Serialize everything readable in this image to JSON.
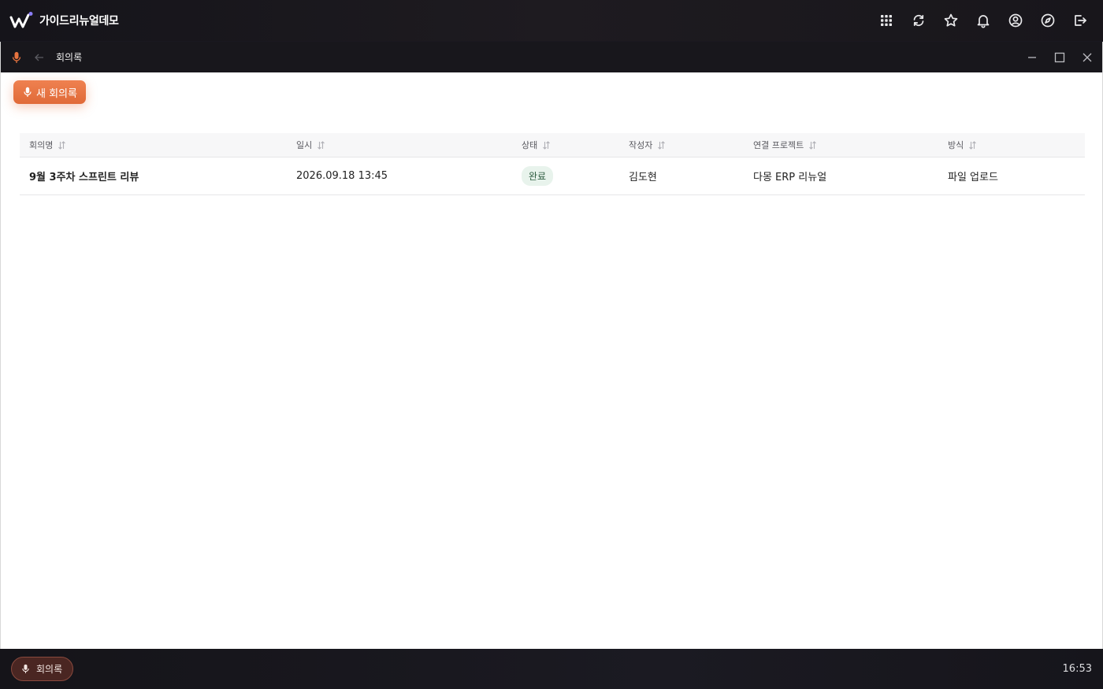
{
  "app": {
    "name": "가이드리뉴얼데모",
    "top_icons": [
      "apps-grid-icon",
      "refresh-icon",
      "star-icon",
      "bell-icon",
      "user-circle-icon",
      "compass-icon",
      "logout-icon"
    ]
  },
  "window": {
    "title": "회의록",
    "new_button_label": "새 회의록"
  },
  "table": {
    "columns": [
      "회의명",
      "일시",
      "상태",
      "작성자",
      "연결 프로젝트",
      "방식"
    ],
    "rows": [
      {
        "name": "9월 3주차 스프린트 리뷰",
        "datetime": "2026.09.18 13:45",
        "status": "완료",
        "author": "김도현",
        "project": "다몽 ERP 리뉴얼",
        "method": "파일 업로드"
      }
    ]
  },
  "taskbar": {
    "item_label": "회의록",
    "clock": "16:53"
  },
  "colors": {
    "accent": "#e8743f",
    "status_done_bg": "#e8f3ec"
  }
}
